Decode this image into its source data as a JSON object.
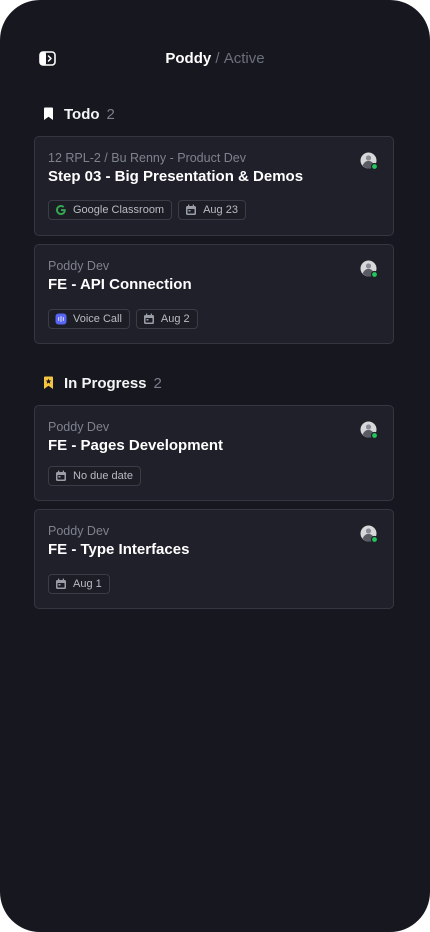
{
  "header": {
    "workspace": "Poddy",
    "separator": "/",
    "status": "Active"
  },
  "sections": [
    {
      "title": "Todo",
      "count": "2",
      "icon": "bookmark-icon",
      "icon_color": "#ffffff",
      "cards": [
        {
          "project": "12 RPL-2 / Bu Renny - Product Dev",
          "title": "Step 03 - Big Presentation & Demos",
          "tags": [
            {
              "icon": "google-icon",
              "label": "Google Classroom"
            },
            {
              "icon": "calendar-icon",
              "label": "Aug 23"
            }
          ]
        },
        {
          "project": "Poddy Dev",
          "title": "FE - API Connection",
          "tags": [
            {
              "icon": "voice-call-icon",
              "label": "Voice Call"
            },
            {
              "icon": "calendar-icon",
              "label": "Aug 2"
            }
          ]
        }
      ]
    },
    {
      "title": "In Progress",
      "count": "2",
      "icon": "bookmark-star-icon",
      "icon_color": "#f5c542",
      "cards": [
        {
          "project": "Poddy Dev",
          "title": "FE - Pages Development",
          "tags": [
            {
              "icon": "calendar-icon",
              "label": "No due date"
            }
          ]
        },
        {
          "project": "Poddy Dev",
          "title": "FE - Type Interfaces",
          "tags": [
            {
              "icon": "calendar-icon",
              "label": "Aug 1"
            }
          ]
        }
      ]
    }
  ],
  "colors": {
    "background": "#17181f",
    "card": "#1f2029",
    "online": "#22c55e",
    "accent_yellow": "#f5c542",
    "voice_call": "#5865f2"
  }
}
